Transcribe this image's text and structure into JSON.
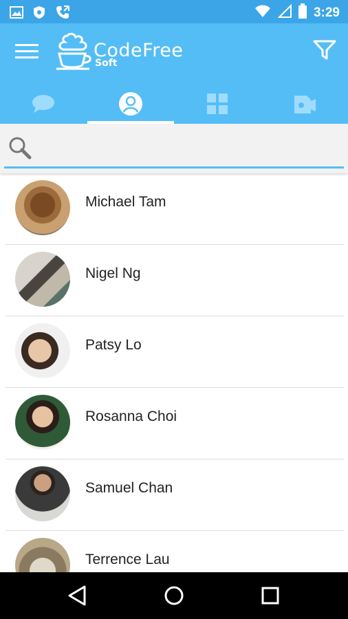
{
  "status_bar": {
    "time": "3:29",
    "left_icons": [
      "image-icon",
      "shield-icon",
      "phone-call-icon"
    ],
    "right_icons": [
      "wifi-icon",
      "signal-icon",
      "battery-icon"
    ]
  },
  "app_bar": {
    "logo_title": "CodeFree",
    "logo_subtitle": "Soft",
    "menu_icon": "hamburger-menu-icon",
    "filter_icon": "filter-icon",
    "colors": {
      "status": "#3ba5e8",
      "header": "#55bdf6",
      "accent": "#ffffff"
    }
  },
  "tabs": [
    {
      "icon": "chat-icon",
      "active": false
    },
    {
      "icon": "contacts-icon",
      "active": true
    },
    {
      "icon": "grid-icon",
      "active": false
    },
    {
      "icon": "media-icon",
      "active": false
    }
  ],
  "search": {
    "placeholder": "",
    "value": ""
  },
  "contacts": [
    {
      "name": "Michael Tam"
    },
    {
      "name": "Nigel Ng"
    },
    {
      "name": "Patsy Lo"
    },
    {
      "name": "Rosanna Choi"
    },
    {
      "name": "Samuel Chan"
    },
    {
      "name": "Terrence Lau"
    }
  ],
  "nav_bar": {
    "icons": [
      "back-icon",
      "home-icon",
      "recents-icon"
    ]
  }
}
